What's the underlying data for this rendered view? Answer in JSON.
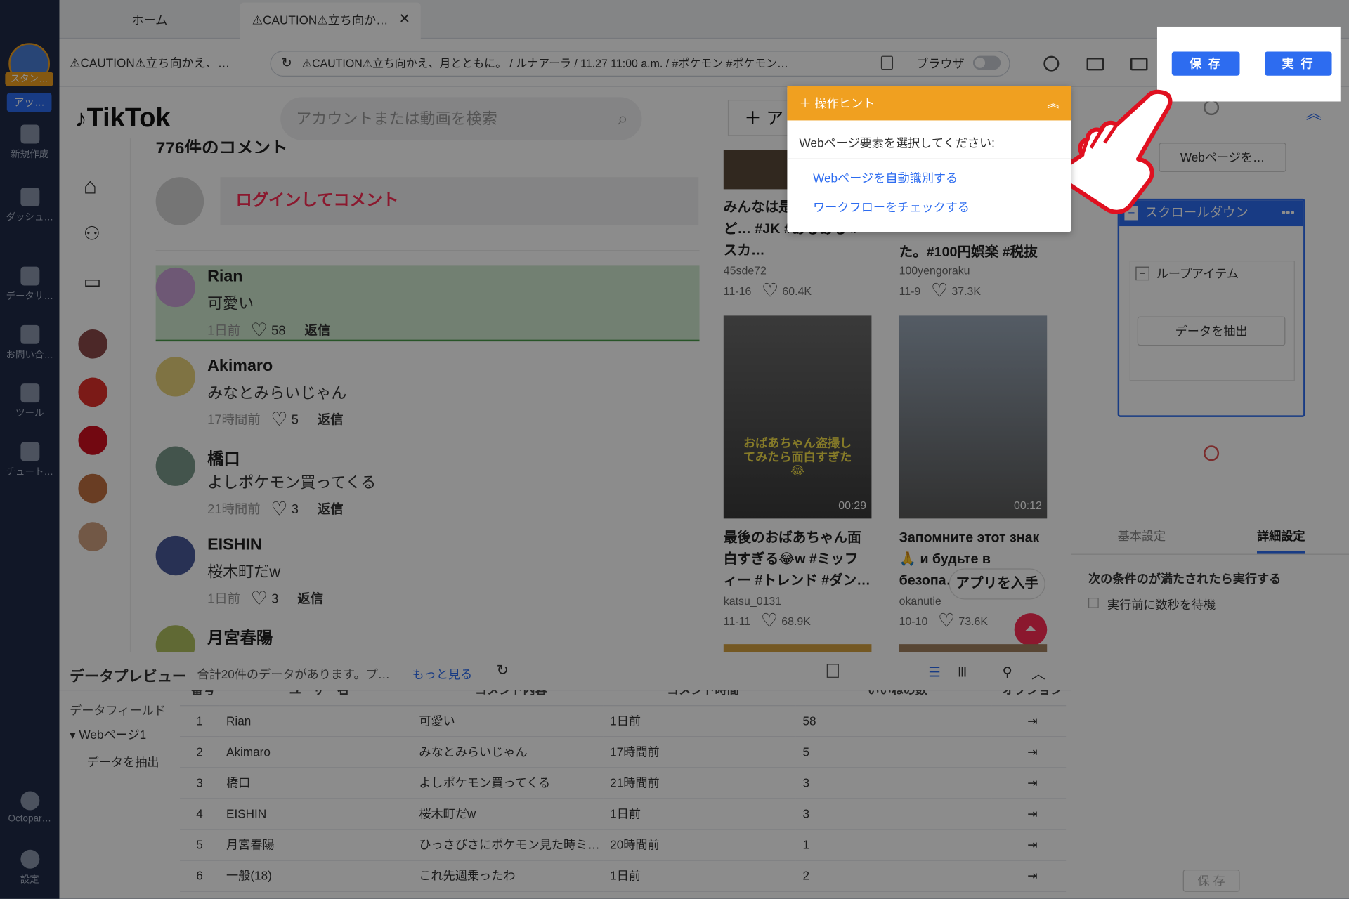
{
  "rail": {
    "brand": "スタン…",
    "badge": "アッ…",
    "items": [
      "新規作成",
      "ダッシュ…",
      "データサ…",
      "お問い合…",
      "ツール",
      "チュート…",
      "Octopar…",
      "設定"
    ]
  },
  "tabs": [
    "ホーム",
    "⚠CAUTION⚠立ち向か…"
  ],
  "address": {
    "page_title": "⚠CAUTION⚠立ち向かえ、…",
    "url": "⚠CAUTION⚠立ち向かえ、月とともに。 / ルナアーラ / 11.27 11:00 a.m. / #ポケモン #ポケモン…",
    "browser_label": "ブラウザ",
    "save_label": "保 存",
    "run_label": "実 行"
  },
  "tiktok": {
    "logo": "TikTok",
    "search_placeholder": "アカウントまたは動画を検索",
    "upload_label": "＋ ア",
    "comment_count": "776件のコメント",
    "login_prompt": "ログインしてコメント",
    "comments": [
      {
        "name": "Rian",
        "text": "可愛い",
        "time": "1日前",
        "likes": "58",
        "reply": "返信",
        "color": "#c9a0d6"
      },
      {
        "name": "Akimaro",
        "text": "みなとみらいじゃん",
        "time": "17時間前",
        "likes": "5",
        "reply": "返信",
        "color": "#e8d27a"
      },
      {
        "name": "橋口",
        "text": "よしポケモン買ってくる",
        "time": "21時間前",
        "likes": "3",
        "reply": "返信",
        "color": "#7a9a8a"
      },
      {
        "name": "EISHIN",
        "text": "桜木町だw",
        "time": "1日前",
        "likes": "3",
        "reply": "返信",
        "color": "#4a5a9a"
      },
      {
        "name": "月宮春陽",
        "text": "",
        "time": "",
        "likes": "",
        "reply": "",
        "color": "#b0c060"
      }
    ],
    "videos": [
      {
        "title": "みんなは是…登下校ど… #JK #あるある #スカ…",
        "user": "45sde72",
        "date": "11-16",
        "likes": "60.4K"
      },
      {
        "title": "た。#100円娯楽 #税抜",
        "user": "100yengoraku",
        "date": "11-9",
        "likes": "37.3K"
      },
      {
        "title": "最後のおばあちゃん面白すぎる😂w #ミッフィー #トレンド #ダン…",
        "user": "katsu_0131",
        "date": "11-11",
        "likes": "68.9K",
        "duration": "00:29",
        "caption": "おばあちゃん盗撮してみたら面白すぎた😂"
      },
      {
        "title": "Запомните этот знак 🙏 и будьте в безопа…",
        "user": "okanutie",
        "date": "10-10",
        "likes": "73.6K",
        "duration": "00:12"
      }
    ],
    "get_app": "アプリを入手"
  },
  "hint": {
    "title": "操作ヒント",
    "prompt": "Webページ要素を選択してください:",
    "link1": "Webページを自動識別する",
    "link2": "ワークフローをチェックする"
  },
  "workflow": {
    "node_web": "Webページを…",
    "node_scroll": "スクロールダウン",
    "node_loop": "ループアイテム",
    "node_extract": "データを抽出",
    "tab_basic": "基本設定",
    "tab_detail": "詳細設定",
    "cond_title": "次の条件のが満たされたら実行する",
    "cond_wait": "実行前に数秒を待機",
    "save": "保 存"
  },
  "preview": {
    "title": "データプレビュー",
    "summary": "合計20件のデータがあります。プ…",
    "more": "もっと見る",
    "fields_label": "データフィールド",
    "tree_page": "Webページ1",
    "tree_extract": "データを抽出",
    "columns": [
      "番号",
      "ユーザー名",
      "コメント内容",
      "コメント時間",
      "いいねの数",
      "オプション"
    ],
    "rows": [
      [
        "1",
        "Rian",
        "可愛い",
        "1日前",
        "58"
      ],
      [
        "2",
        "Akimaro",
        "みなとみらいじゃん",
        "17時間前",
        "5"
      ],
      [
        "3",
        "橋口",
        "よしポケモン買ってくる",
        "21時間前",
        "3"
      ],
      [
        "4",
        "EISHIN",
        "桜木町だw",
        "1日前",
        "3"
      ],
      [
        "5",
        "月宮春陽",
        "ひっさびさにポケモン見た時ミ…",
        "20時間前",
        "1"
      ],
      [
        "6",
        "一般(18)",
        "これ先週乗ったわ",
        "1日前",
        "2"
      ]
    ]
  }
}
